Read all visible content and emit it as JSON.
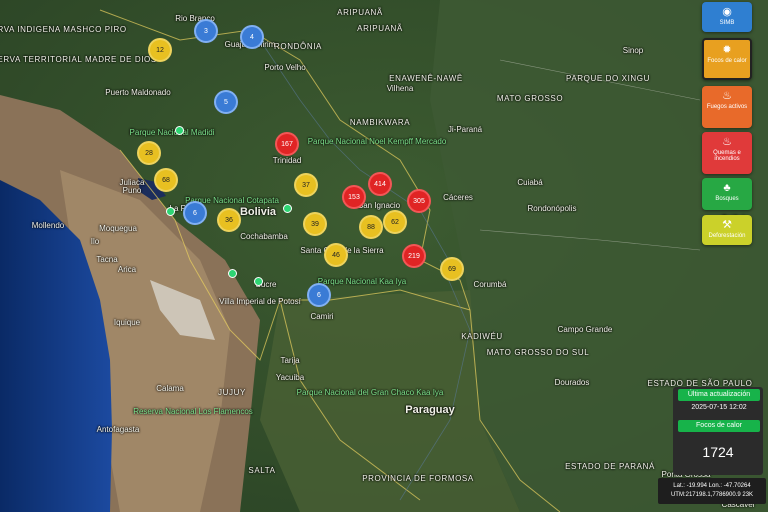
{
  "map_labels": {
    "countries": [
      {
        "text": "Bolivia"
      },
      {
        "text": "Paraguay"
      }
    ],
    "regions": [
      {
        "text": "RESERVA INDIGENA MASHCO PIRO"
      },
      {
        "text": "RESERVA TERRITORIAL MADRE DE DIOS"
      },
      {
        "text": "RONDÔNIA"
      },
      {
        "text": "ARIPUANÃ"
      },
      {
        "text": "ENAWENÊ-NAWÊ"
      },
      {
        "text": "NAMBIKWARA"
      },
      {
        "text": "MATO GROSSO"
      },
      {
        "text": "MATO GROSSO DO SUL"
      },
      {
        "text": "JUJUY"
      },
      {
        "text": "SALTA"
      },
      {
        "text": "PROVINCIA DE FORMOSA"
      },
      {
        "text": "ESTADO DE SÃO PAULO"
      },
      {
        "text": "ESTADO DE PARANÁ"
      },
      {
        "text": "KADIWÉU"
      },
      {
        "text": "PARQUE DO XINGU"
      },
      {
        "text": "ARIPUANÃ"
      }
    ],
    "cities": [
      {
        "text": "Rio Branco"
      },
      {
        "text": "Guajará-Mirim"
      },
      {
        "text": "Porto Velho"
      },
      {
        "text": "Puerto Maldonado"
      },
      {
        "text": "Trinidad"
      },
      {
        "text": "Cochabamba"
      },
      {
        "text": "Santa Cruz de la Sierra"
      },
      {
        "text": "La Paz"
      },
      {
        "text": "Juliaca"
      },
      {
        "text": "Puno"
      },
      {
        "text": "Moquegua"
      },
      {
        "text": "Tacna"
      },
      {
        "text": "Arica"
      },
      {
        "text": "Iquique"
      },
      {
        "text": "Calama"
      },
      {
        "text": "Antofagasta"
      },
      {
        "text": "Tarija"
      },
      {
        "text": "Camiri"
      },
      {
        "text": "Sucre"
      },
      {
        "text": "Villa Imperial de Potosí"
      },
      {
        "text": "Corumbá"
      },
      {
        "text": "Cáceres"
      },
      {
        "text": "Cuiabá"
      },
      {
        "text": "Campo Grande"
      },
      {
        "text": "Dourados"
      },
      {
        "text": "Rondonópolis"
      },
      {
        "text": "Vilhena"
      },
      {
        "text": "Ji-Paraná"
      },
      {
        "text": "Sinop"
      },
      {
        "text": "Mollendo"
      },
      {
        "text": "Ilo"
      },
      {
        "text": "Yacuiba"
      },
      {
        "text": "San Ignacio"
      },
      {
        "text": "Cascavel"
      },
      {
        "text": "Ponta Grossa"
      },
      {
        "text": "Goiânia"
      }
    ],
    "parks": [
      {
        "text": "Parque Nacional Madidi"
      },
      {
        "text": "Parque Nacional Noel Kempff Mercado"
      },
      {
        "text": "Parque Nacional Kaa Iya"
      },
      {
        "text": "Parque Nacional Cotapata"
      },
      {
        "text": "Reserva Nacional Los Flamencos"
      },
      {
        "text": "Parque Nacional del Gran Chaco Kaa Iya"
      }
    ]
  },
  "clusters": [
    {
      "value": "12",
      "color": "yellow"
    },
    {
      "value": "3",
      "color": "blue"
    },
    {
      "value": "4",
      "color": "blue"
    },
    {
      "value": "5",
      "color": "blue"
    },
    {
      "value": "28",
      "color": "yellow"
    },
    {
      "value": "68",
      "color": "yellow"
    },
    {
      "value": "167",
      "color": "red"
    },
    {
      "value": "37",
      "color": "yellow"
    },
    {
      "value": "153",
      "color": "red"
    },
    {
      "value": "414",
      "color": "red"
    },
    {
      "value": "305",
      "color": "red"
    },
    {
      "value": "39",
      "color": "yellow"
    },
    {
      "value": "88",
      "color": "yellow"
    },
    {
      "value": "62",
      "color": "yellow"
    },
    {
      "value": "6",
      "color": "blue"
    },
    {
      "value": "36",
      "color": "yellow"
    },
    {
      "value": "46",
      "color": "yellow"
    },
    {
      "value": "219",
      "color": "red"
    },
    {
      "value": "69",
      "color": "yellow"
    },
    {
      "value": "6",
      "color": "blue"
    }
  ],
  "layer_buttons": [
    {
      "label": "SIMB",
      "icon": "globe-icon",
      "color": "#2f7fd1"
    },
    {
      "label": "Focos de calor",
      "icon": "fire-icon",
      "color": "#e8a020"
    },
    {
      "label": "Fuegos activos",
      "icon": "flame-icon",
      "color": "#e86a2a"
    },
    {
      "label": "Quemas e incendios",
      "icon": "burn-icon",
      "color": "#e03a3a"
    },
    {
      "label": "Bosques",
      "icon": "tree-icon",
      "color": "#27a844"
    },
    {
      "label": "Deforestación",
      "icon": "saw-icon",
      "color": "#cbd12a"
    }
  ],
  "info_panel": {
    "update_label": "Última actualización",
    "update_value": "2025-07-15 12:02",
    "layer_label": "Focos de calor",
    "count": "1724"
  },
  "coords": {
    "line1": "Lat.: -19.994 Lon.: -47.70264",
    "line2": "UTM:217198.1,7786900.9 23K"
  }
}
